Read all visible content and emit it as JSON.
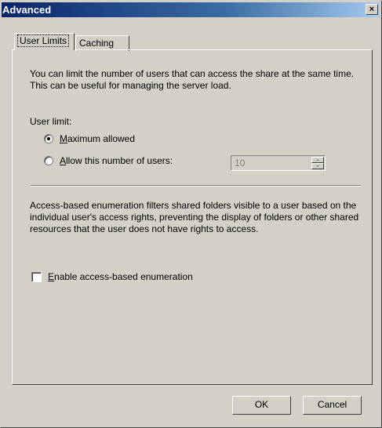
{
  "window": {
    "title": "Advanced",
    "close_glyph": "×"
  },
  "tabs": [
    {
      "label": "User Limits",
      "active": true
    },
    {
      "label": "Caching",
      "active": false
    }
  ],
  "user_limits": {
    "description": "You can limit the number of users that can access the share at the same time. This can be useful for managing the server load.",
    "user_limit_label": "User limit:",
    "options": [
      {
        "label_rest": "aximum allowed",
        "accel": "M",
        "selected": true
      },
      {
        "label_rest": "llow this number of users:",
        "accel": "A",
        "selected": false
      }
    ],
    "spin_value": "10",
    "abe_description": "Access-based enumeration filters shared folders visible to a user based on the individual user's access rights, preventing the display of folders or other shared resources that the user does not have rights to access.",
    "abe_checkbox": {
      "accel": "E",
      "label_rest": "nable access-based enumeration",
      "checked": false
    }
  },
  "buttons": {
    "ok": "OK",
    "cancel": "Cancel"
  },
  "colors": {
    "dialog_bg": "#d4d0c8",
    "title_bg_start": "#0a246a",
    "title_bg_end": "#a6caf0"
  }
}
